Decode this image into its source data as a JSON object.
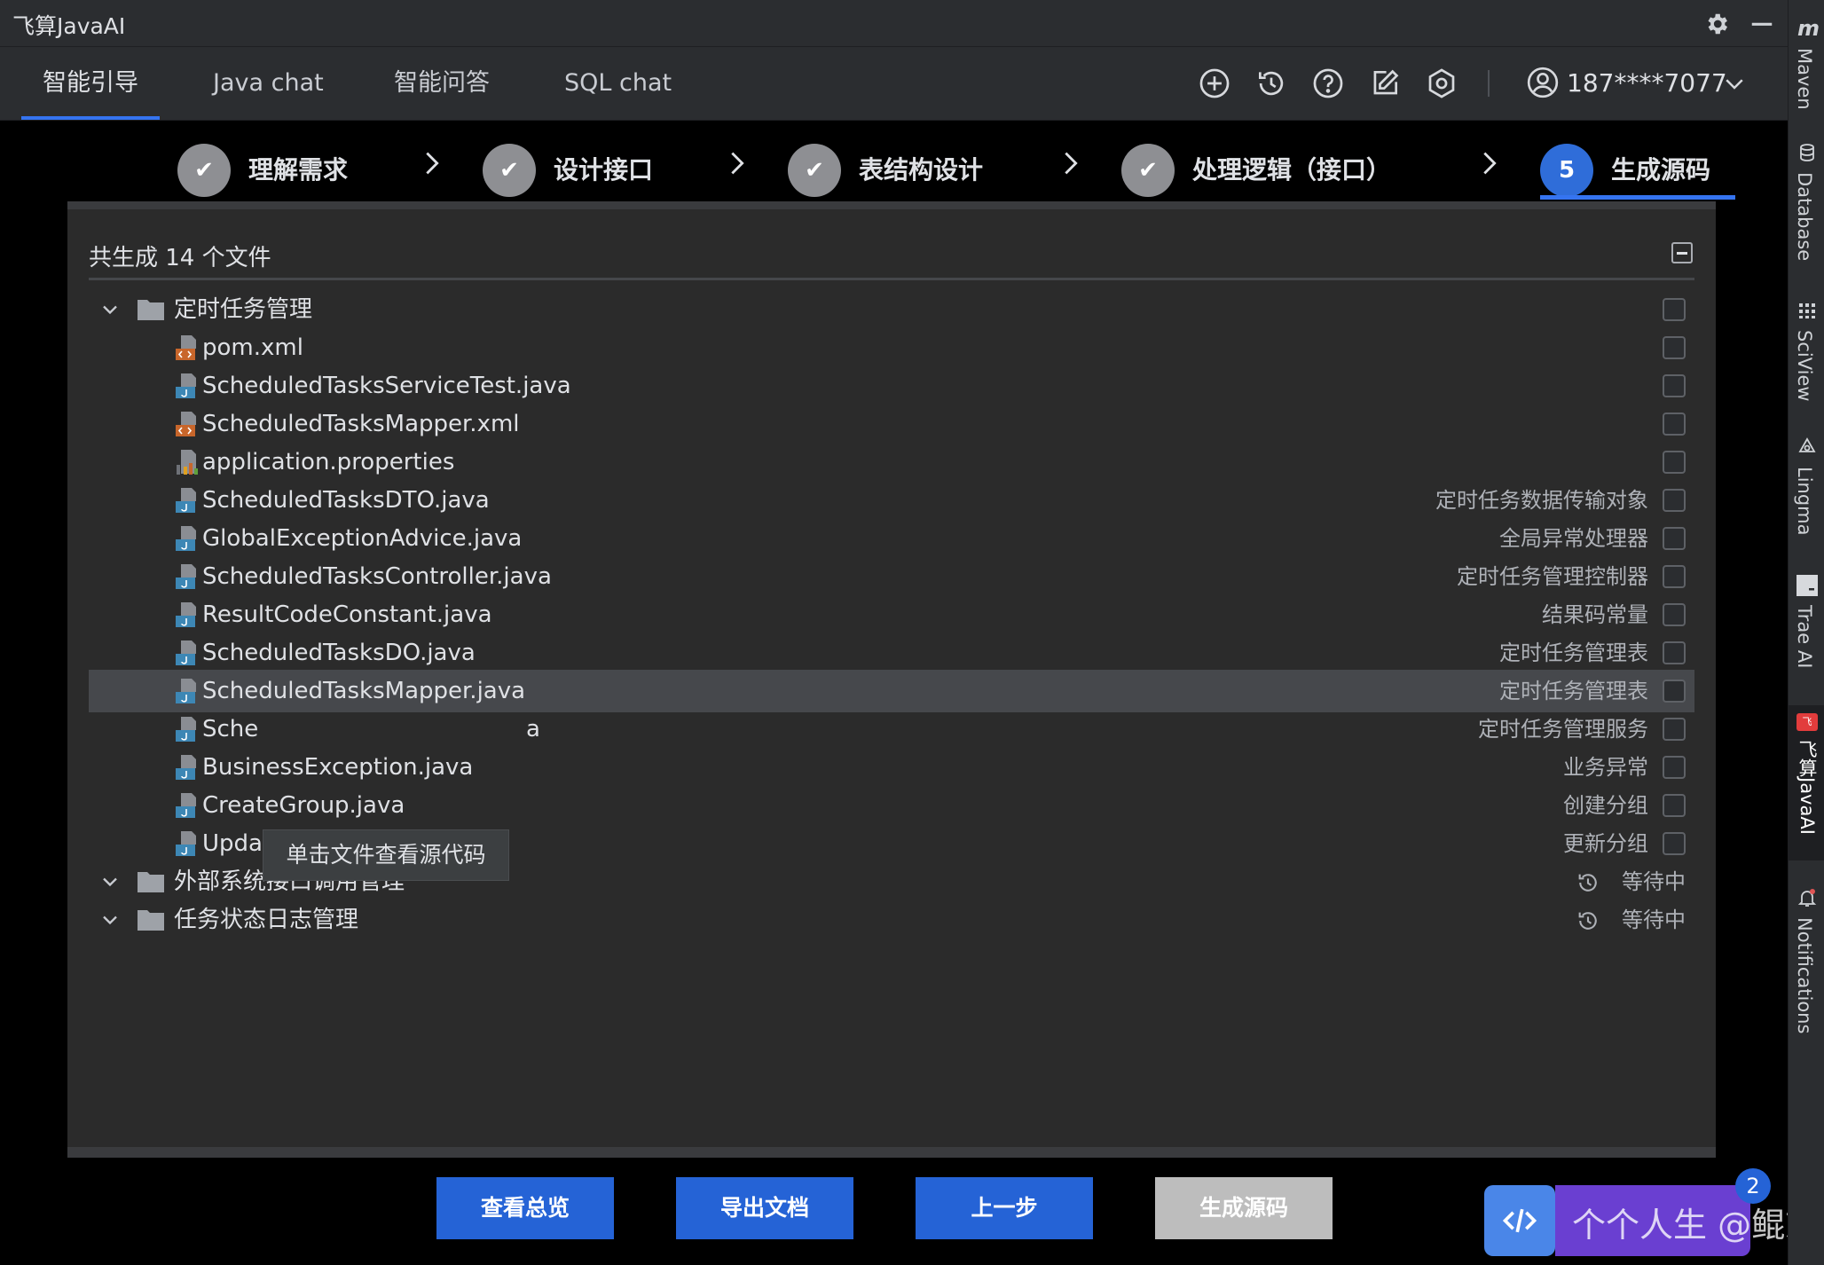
{
  "app": {
    "title": "飞算JavaAI"
  },
  "tabs": [
    {
      "label": "智能引导",
      "active": true
    },
    {
      "label": "Java chat"
    },
    {
      "label": "智能问答"
    },
    {
      "label": "SQL chat"
    }
  ],
  "toolbar": {
    "icons": [
      "add-icon",
      "history-icon",
      "help-icon",
      "edit-icon",
      "settings-icon"
    ],
    "user": "187****7077"
  },
  "steps": [
    {
      "label": "理解需求",
      "status": "done",
      "mark": "✔"
    },
    {
      "label": "设计接口",
      "status": "done",
      "mark": "✔"
    },
    {
      "label": "表结构设计",
      "status": "done",
      "mark": "✔"
    },
    {
      "label": "处理逻辑（接口）",
      "status": "done",
      "mark": "✔"
    },
    {
      "label": "生成源码",
      "status": "current",
      "mark": "5"
    }
  ],
  "summary": "共生成 14 个文件",
  "groups": [
    {
      "name": "定时任务管理",
      "files": [
        {
          "name": "pom.xml",
          "desc": "",
          "type": "xml"
        },
        {
          "name": "ScheduledTasksServiceTest.java",
          "desc": "",
          "type": "java"
        },
        {
          "name": "ScheduledTasksMapper.xml",
          "desc": "",
          "type": "xml"
        },
        {
          "name": "application.properties",
          "desc": "",
          "type": "properties"
        },
        {
          "name": "ScheduledTasksDTO.java",
          "desc": "定时任务数据传输对象",
          "type": "java"
        },
        {
          "name": "GlobalExceptionAdvice.java",
          "desc": "全局异常处理器",
          "type": "java"
        },
        {
          "name": "ScheduledTasksController.java",
          "desc": "定时任务管理控制器",
          "type": "java"
        },
        {
          "name": "ResultCodeConstant.java",
          "desc": "结果码常量",
          "type": "java"
        },
        {
          "name": "ScheduledTasksDO.java",
          "desc": "定时任务管理表",
          "type": "java"
        },
        {
          "name": "ScheduledTasksMapper.java",
          "desc": "定时任务管理表",
          "type": "java"
        },
        {
          "name": "Sche",
          "name_tail": "a",
          "desc": "定时任务管理服务",
          "type": "java"
        },
        {
          "name": "BusinessException.java",
          "desc": "业务异常",
          "type": "java"
        },
        {
          "name": "CreateGroup.java",
          "desc": "创建分组",
          "type": "java"
        },
        {
          "name": "UpdateGroup.java",
          "desc": "更新分组",
          "type": "java"
        }
      ]
    },
    {
      "name": "外部系统接口调用管理",
      "status": "等待中"
    },
    {
      "name": "任务状态日志管理",
      "status": "等待中"
    }
  ],
  "tooltip": "单击文件查看源代码",
  "buttons": {
    "overview": "查看总览",
    "export": "导出文档",
    "prev": "上一步",
    "generate": "生成源码"
  },
  "floating": {
    "badge": "2",
    "text": "个个人生 @鲲志说",
    "icon": "code-icon"
  },
  "right_sidebar": [
    "Maven",
    "Database",
    "SciView",
    "Lingma",
    "Trae AI",
    "飞算JavaAI",
    "Notifications"
  ],
  "colors": {
    "accent": "#3574f0",
    "button": "#2563d6",
    "disabled": "#bdbdbd"
  }
}
